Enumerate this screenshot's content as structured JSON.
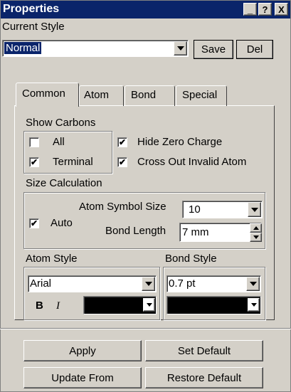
{
  "window": {
    "title": "Properties",
    "title_bar_color": "#0a246a",
    "controls": {
      "minimize": "_",
      "help": "?",
      "close": "X"
    }
  },
  "current_style": {
    "label": "Current Style",
    "value": "Normal",
    "save_label": "Save",
    "del_label": "Del"
  },
  "tabs": [
    {
      "label": "Common",
      "active": true
    },
    {
      "label": "Atom",
      "active": false
    },
    {
      "label": "Bond",
      "active": false
    },
    {
      "label": "Special",
      "active": false
    }
  ],
  "show_carbons": {
    "label": "Show Carbons",
    "all": {
      "label": "All",
      "checked": false
    },
    "terminal": {
      "label": "Terminal",
      "checked": true
    },
    "hide_zero_charge": {
      "label": "Hide Zero Charge",
      "checked": true
    },
    "cross_out_invalid": {
      "label": "Cross Out Invalid Atom",
      "checked": true
    }
  },
  "size_calculation": {
    "label": "Size Calculation",
    "auto": {
      "label": "Auto",
      "checked": true
    },
    "atom_symbol_size": {
      "label": "Atom Symbol Size",
      "value": "10"
    },
    "bond_length": {
      "label": "Bond Length",
      "value": "7 mm"
    }
  },
  "atom_style": {
    "label": "Atom Style",
    "font": "Arial",
    "bold": "B",
    "italic": "I",
    "color": "#000000"
  },
  "bond_style": {
    "label": "Bond Style",
    "width": "0.7 pt",
    "color": "#000000"
  },
  "buttons": {
    "apply": "Apply",
    "set_default": "Set Default",
    "update_from": "Update From",
    "restore_default": "Restore Default"
  }
}
